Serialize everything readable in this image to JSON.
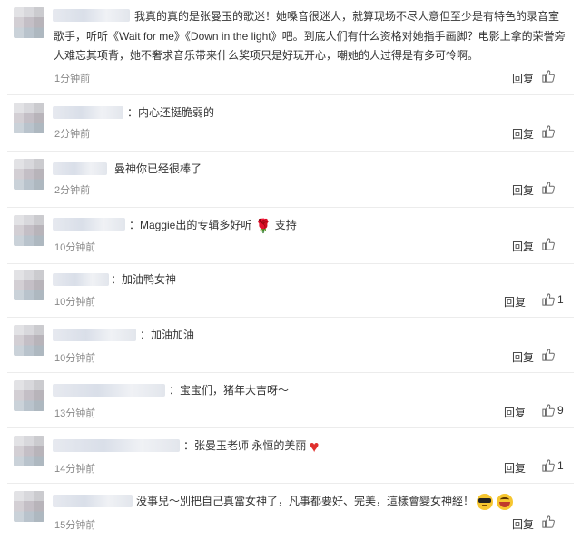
{
  "comments": [
    {
      "text_lines": [
        "我真的真的是张曼玉的歌迷！她嗓音很迷人，就算现场不尽人意但至少是有特色的录音室",
        "歌手，听听《Wait for me》《Down in the light》吧。到底人们有什么资格对她指手画脚？电影上拿的荣誉旁",
        "人难忘其项背，她不奢求音乐带来什么奖项只是好玩开心，嘲她的人过得是有多可怜啊。"
      ],
      "time": "1分钟前",
      "reply": "回复"
    },
    {
      "text": "：内心还挺脆弱的",
      "time": "2分钟前",
      "reply": "回复"
    },
    {
      "text": "曼神你已经很棒了",
      "time": "2分钟前",
      "reply": "回复"
    },
    {
      "text": "：Maggie出的专辑多好听",
      "suffix": "支持",
      "time": "10分钟前",
      "reply": "回复"
    },
    {
      "text": "：加油鸭女神",
      "time": "10分钟前",
      "reply": "回复",
      "likes": "1"
    },
    {
      "text": "：加油加油",
      "time": "10分钟前",
      "reply": "回复"
    },
    {
      "text": "：宝宝们，猪年大吉呀～",
      "time": "13分钟前",
      "reply": "回复",
      "likes": "9"
    },
    {
      "text": "：张曼玉老师 永恒的美丽",
      "time": "14分钟前",
      "reply": "回复",
      "likes": "1"
    },
    {
      "text": "没事兒～別把自己真當女神了，凡事都要好、完美，這樣會變女神經！",
      "time": "15分钟前",
      "reply": "回复"
    }
  ],
  "icons": {
    "like": "thumbs-up-icon",
    "rose": "rose-emoji-icon",
    "heart": "red-heart-emoji-icon",
    "cool": "sunglasses-emoji-icon",
    "laugh": "laughing-emoji-icon"
  }
}
